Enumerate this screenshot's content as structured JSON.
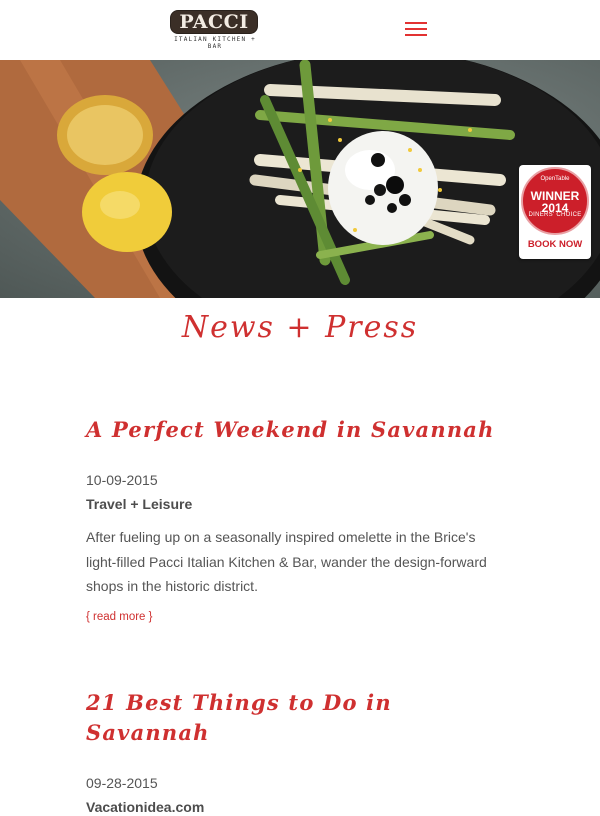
{
  "header": {
    "logo_text": "PACCI",
    "logo_subtitle": "ITALIAN KITCHEN + BAR",
    "menu_icon": "hamburger-menu-icon"
  },
  "hero": {
    "badge": {
      "provider": "OpenTable",
      "title": "WINNER 2014",
      "subtitle": "DINERS' CHOICE",
      "cta": "BOOK NOW",
      "color": "#cc1f2a"
    }
  },
  "page": {
    "title": "News + Press",
    "accent_color": "#cf3030"
  },
  "articles": [
    {
      "title": "A Perfect Weekend in Savannah",
      "date": "10-09-2015",
      "source": "Travel + Leisure",
      "excerpt": "After fueling up on a seasonally inspired omelette in the Brice's light-filled Pacci Italian Kitchen & Bar, wander the design-forward shops in the historic district.",
      "read_more": "{ read more }"
    },
    {
      "title": "21 Best Things to Do in Savannah",
      "date": "09-28-2015",
      "source": "Vacationidea.com"
    }
  ]
}
